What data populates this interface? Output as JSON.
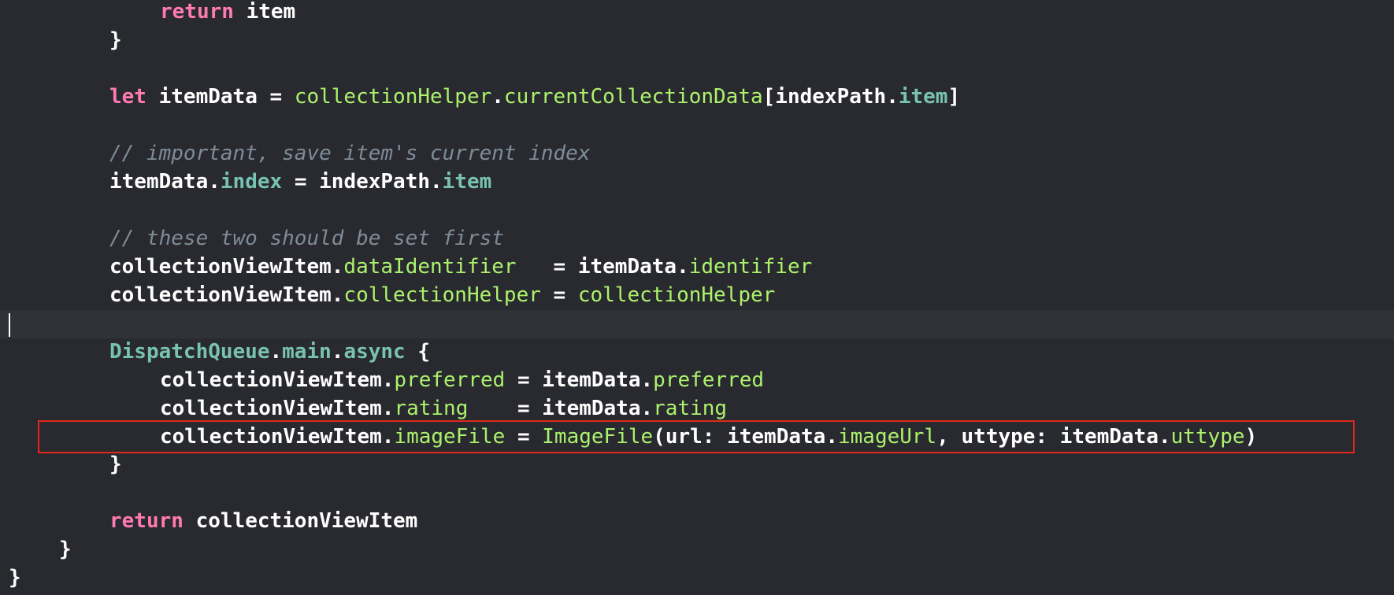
{
  "lines": {
    "l1": {
      "kw": "return",
      "rest": " item"
    },
    "l2": {
      "text": "}"
    },
    "l4": {
      "kw": "let",
      "a": " itemData = ",
      "b": "collectionHelper",
      "c": ".",
      "d": "currentCollectionData",
      "e": "[indexPath.",
      "f": "item",
      "g": "]"
    },
    "l6": {
      "comment": "// important, save item's current index"
    },
    "l7": {
      "a": "itemData.",
      "b": "index",
      "c": " = indexPath.",
      "d": "item"
    },
    "l9": {
      "comment": "// these two should be set first"
    },
    "l10": {
      "a": "collectionViewItem.",
      "b": "dataIdentifier",
      "c": "   = itemData.",
      "d": "identifier"
    },
    "l11": {
      "a": "collectionViewItem.",
      "b": "collectionHelper",
      "c": " = ",
      "d": "collectionHelper"
    },
    "l13": {
      "a": "DispatchQueue",
      "b": ".",
      "c": "main",
      "d": ".",
      "e": "async",
      "f": " {"
    },
    "l14": {
      "a": "collectionViewItem.",
      "b": "preferred",
      "c": " = itemData.",
      "d": "preferred"
    },
    "l15": {
      "a": "collectionViewItem.",
      "b": "rating",
      "c": "    = itemData.",
      "d": "rating"
    },
    "l16": {
      "a": "collectionViewItem.",
      "b": "imageFile",
      "c": " = ",
      "d": "ImageFile",
      "e": "(url: itemData.",
      "f": "imageUrl",
      "g": ", uttype: itemData.",
      "h": "uttype",
      "i": ")"
    },
    "l17": {
      "text": "}"
    },
    "l19": {
      "kw": "return",
      "rest": " collectionViewItem"
    },
    "l20": {
      "text": "}"
    },
    "l21": {
      "text": "}"
    }
  },
  "colors": {
    "background": "#292a30",
    "keyword": "#ff7ab2",
    "property": "#78c2b3",
    "project_symbol": "#acf26c",
    "comment": "#7f8c98",
    "highlight_border": "#e0291a"
  }
}
